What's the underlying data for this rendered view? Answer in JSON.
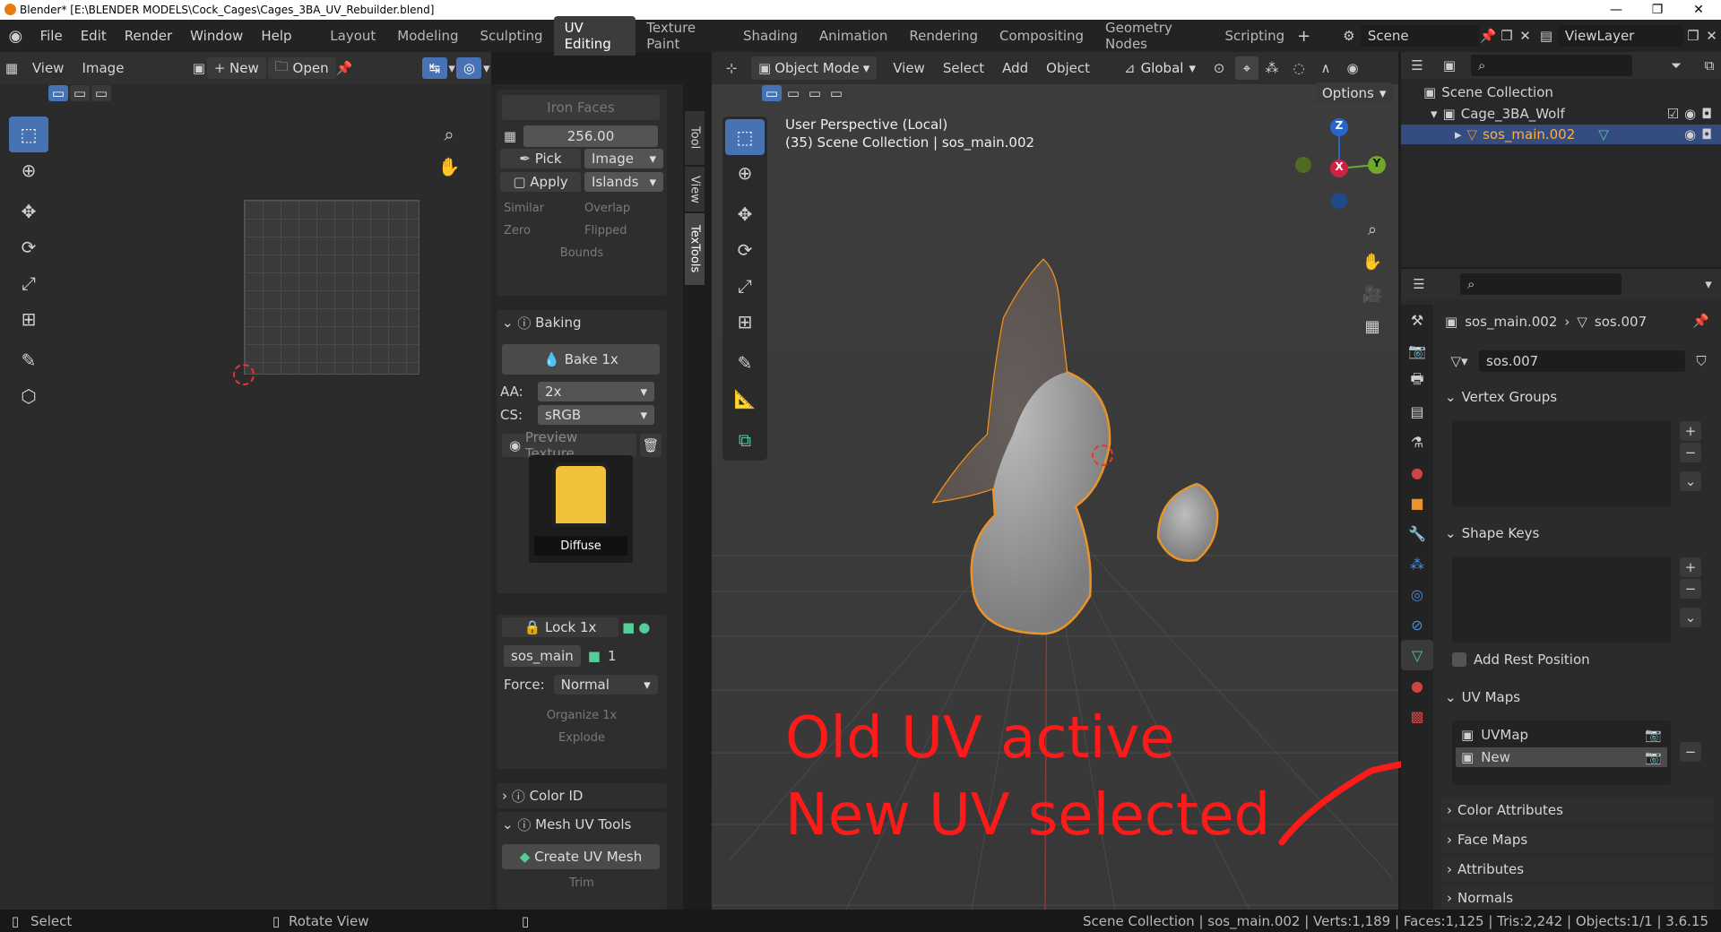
{
  "window": {
    "title": "Blender* [E:\\BLENDER MODELS\\Cock_Cages\\Cages_3BA_UV_Rebuilder.blend]",
    "minimize": "—",
    "maximize": "❐",
    "close": "✕"
  },
  "menu": [
    "File",
    "Edit",
    "Render",
    "Window",
    "Help"
  ],
  "workspaces": [
    "Layout",
    "Modeling",
    "Sculpting",
    "UV Editing",
    "Texture Paint",
    "Shading",
    "Animation",
    "Rendering",
    "Compositing",
    "Geometry Nodes",
    "Scripting"
  ],
  "active_workspace": "UV Editing",
  "scene": "Scene",
  "view_layer": "ViewLayer",
  "uv_editor": {
    "view": "View",
    "image": "Image",
    "new": "New",
    "open": "Open"
  },
  "textools": {
    "iron_faces": "Iron Faces",
    "size_value": "256.00",
    "pick": "Pick",
    "image": "Image",
    "apply": "Apply",
    "islands": "Islands",
    "similar": "Similar",
    "overlap": "Overlap",
    "zero": "Zero",
    "flipped": "Flipped",
    "bounds": "Bounds",
    "baking_header": "Baking",
    "bake_button": "Bake 1x",
    "aa_label": "AA:",
    "aa_value": "2x",
    "cs_label": "CS:",
    "cs_value": "sRGB",
    "preview_texture": "Preview Texture",
    "diffuse": "Diffuse",
    "lock_button": "Lock 1x",
    "sos_main": "sos_main",
    "count": "1",
    "force_label": "Force:",
    "force_value": "Normal",
    "organize": "Organize 1x",
    "explode": "Explode",
    "color_id": "Color ID",
    "mesh_uv_tools": "Mesh UV Tools",
    "create_uv_mesh": "Create UV Mesh",
    "trim": "Trim"
  },
  "side_tabs": [
    "Tool",
    "View",
    "TexTools"
  ],
  "viewport": {
    "mode": "Object Mode",
    "menus": [
      "View",
      "Select",
      "Add",
      "Object"
    ],
    "orientation": "Global",
    "options": "Options",
    "info_line1": "User Perspective (Local)",
    "info_line2": "(35) Scene Collection | sos_main.002",
    "gizmo": {
      "z": "Z",
      "y": "Y",
      "x": "X"
    }
  },
  "outliner": {
    "scene_collection": "Scene Collection",
    "collection": "Cage_3BA_Wolf",
    "object": "sos_main.002"
  },
  "properties": {
    "breadcrumb_object": "sos_main.002",
    "breadcrumb_mesh": "sos.007",
    "mesh_name": "sos.007",
    "vertex_groups": "Vertex Groups",
    "shape_keys": "Shape Keys",
    "add_rest_position": "Add Rest Position",
    "uv_maps": "UV Maps",
    "uv_items": [
      "UVMap",
      "New"
    ],
    "color_attributes": "Color Attributes",
    "face_maps": "Face Maps",
    "attributes": "Attributes",
    "normals": "Normals"
  },
  "annotation": {
    "line1": "Old UV active",
    "line2": "New UV selected",
    "color": "#ff1a1a"
  },
  "status": {
    "select": "Select",
    "rotate": "Rotate View",
    "stats": "Scene Collection | sos_main.002 | Verts:1,189 | Faces:1,125 | Tris:2,242 | Objects:1/1 | 3.6.15"
  },
  "colors": {
    "accent": "#4772b3",
    "selection": "#e9932b",
    "annotation": "#ff1a1a"
  }
}
